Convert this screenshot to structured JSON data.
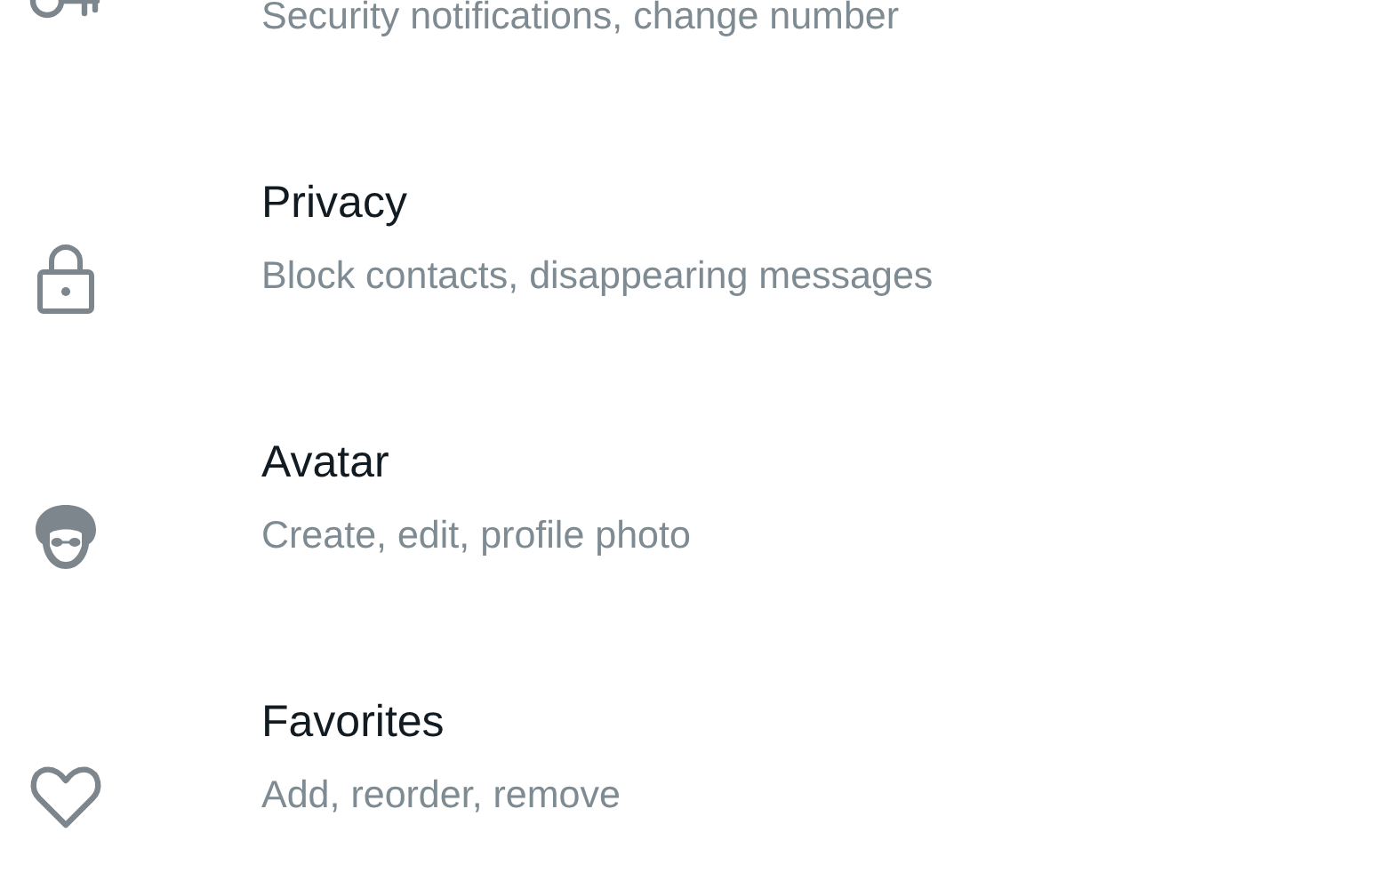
{
  "settings": [
    {
      "subtitle": "Security notifications, change number"
    },
    {
      "title": "Privacy",
      "subtitle": "Block contacts, disappearing messages"
    },
    {
      "title": "Avatar",
      "subtitle": "Create, edit, profile photo"
    },
    {
      "title": "Favorites",
      "subtitle": "Add, reorder, remove"
    }
  ]
}
